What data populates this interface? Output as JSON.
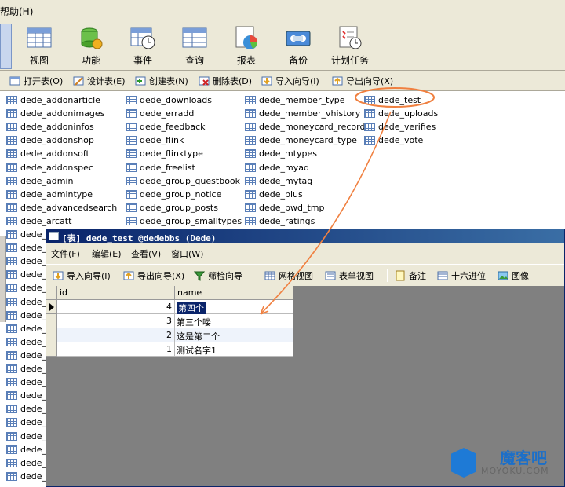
{
  "menubar": {
    "help": "帮助(H)"
  },
  "toolbar": [
    {
      "label": "视图",
      "icon": "view-icon"
    },
    {
      "label": "功能",
      "icon": "function-icon"
    },
    {
      "label": "事件",
      "icon": "event-icon"
    },
    {
      "label": "查询",
      "icon": "query-icon"
    },
    {
      "label": "报表",
      "icon": "report-icon"
    },
    {
      "label": "备份",
      "icon": "backup-icon"
    },
    {
      "label": "计划任务",
      "icon": "schedule-icon"
    }
  ],
  "objbar": [
    {
      "label": "打开表(O)"
    },
    {
      "label": "设计表(E)"
    },
    {
      "label": "创建表(N)"
    },
    {
      "label": "删除表(D)"
    },
    {
      "label": "导入向导(I)"
    },
    {
      "label": "导出向导(X)"
    }
  ],
  "tables": {
    "col1": [
      "dede_addonarticle",
      "dede_addonimages",
      "dede_addoninfos",
      "dede_addonshop",
      "dede_addonsoft",
      "dede_addonspec",
      "dede_admin",
      "dede_admintype",
      "dede_advancedsearch",
      "dede_arcatt"
    ],
    "col1_trunc": [
      "dede_",
      "dede_",
      "dede_",
      "dede_",
      "dede_",
      "dede_",
      "dede_",
      "dede_",
      "dede_",
      "dede_",
      "dede_",
      "dede_",
      "dede_",
      "dede_",
      "dede_",
      "dede_",
      "dede_",
      "dede_",
      "dede_"
    ],
    "col2": [
      "dede_downloads",
      "dede_erradd",
      "dede_feedback",
      "dede_flink",
      "dede_flinktype",
      "dede_freelist",
      "dede_group_guestbook",
      "dede_group_notice",
      "dede_group_posts",
      "dede_group_smalltypes"
    ],
    "col3": [
      "dede_member_type",
      "dede_member_vhistory",
      "dede_moneycard_record",
      "dede_moneycard_type",
      "dede_mtypes",
      "dede_myad",
      "dede_mytag",
      "dede_plus",
      "dede_pwd_tmp",
      "dede_ratings"
    ],
    "col4": [
      "dede_test",
      "dede_uploads",
      "dede_verifies",
      "dede_vote"
    ]
  },
  "child": {
    "title": "[表] dede_test @dedebbs (Dede)",
    "menu": [
      "文件(F)",
      "编辑(E)",
      "查看(V)",
      "窗口(W)"
    ],
    "tools": [
      "导入向导(I)",
      "导出向导(X)",
      "筛检向导",
      "网格视图",
      "表单视图",
      "备注",
      "十六进位",
      "图像"
    ],
    "grid": {
      "columns": [
        "id",
        "name"
      ],
      "rows": [
        {
          "id": "4",
          "name": "第四个"
        },
        {
          "id": "3",
          "name": "第三个喽"
        },
        {
          "id": "2",
          "name": "这是第二个"
        },
        {
          "id": "1",
          "name": "测试名字1"
        }
      ]
    }
  },
  "watermark": {
    "brand": "魔客吧",
    "url": "MOYOKU.COM"
  },
  "colors": {
    "highlight_circle": "#f08040",
    "title_bar": "#0a246a",
    "selection": "#0a246a"
  }
}
